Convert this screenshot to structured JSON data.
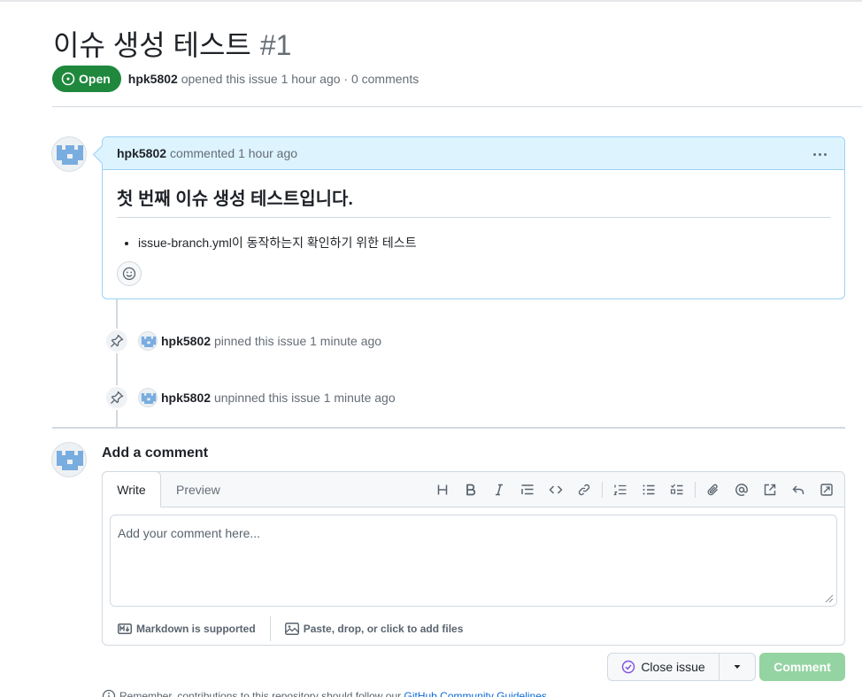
{
  "issue": {
    "title": "이슈 생성 테스트",
    "number": "#1",
    "state": "Open",
    "author": "hpk5802",
    "meta_suffix": "opened this issue 1 hour ago · 0 comments"
  },
  "comment": {
    "author": "hpk5802",
    "when": "commented 1 hour ago",
    "heading": "첫 번째 이슈 생성 테스트입니다.",
    "bullets": [
      "issue-branch.yml이 동작하는지 확인하기 위한 테스트"
    ]
  },
  "events": [
    {
      "icon": "pin-icon",
      "actor": "hpk5802",
      "text": "pinned this issue 1 minute ago"
    },
    {
      "icon": "pin-icon",
      "actor": "hpk5802",
      "text": "unpinned this issue 1 minute ago"
    }
  ],
  "add_comment": {
    "title": "Add a comment",
    "tabs": [
      "Write",
      "Preview"
    ],
    "toolbar_icons": [
      "heading-icon",
      "bold-icon",
      "italic-icon",
      "quote-icon",
      "code-icon",
      "link-icon",
      "ordered-list-icon",
      "unordered-list-icon",
      "task-list-icon",
      "attach-icon",
      "mention-icon",
      "reference-icon",
      "undo-icon",
      "fullscreen-icon"
    ],
    "placeholder": "Add your comment here...",
    "markdown_label": "Markdown is supported",
    "attach_label": "Paste, drop, or click to add files"
  },
  "buttons": {
    "close_issue": "Close issue",
    "comment": "Comment"
  },
  "footer": {
    "remember_text": "Remember, contributions to this repository should follow our",
    "guidelines_link": "GitHub Community Guidelines"
  },
  "colors": {
    "open_green": "#1f883d",
    "comment_header_blue": "#ddf4ff",
    "comment_border_blue": "#9cd1f5",
    "comment_button_disabled": "#94d3a2",
    "close_issue_icon": "#8250df"
  }
}
